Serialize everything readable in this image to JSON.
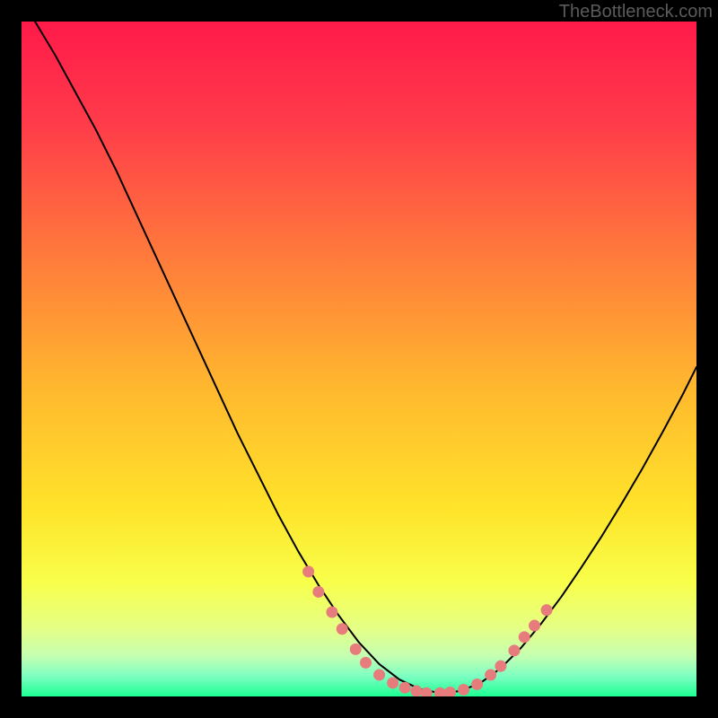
{
  "watermark": "TheBottleneck.com",
  "chart_data": {
    "type": "line",
    "title": "",
    "xlabel": "",
    "ylabel": "",
    "xlim": [
      0,
      100
    ],
    "ylim": [
      0,
      100
    ],
    "grid": false,
    "legend": false,
    "background_gradient": {
      "stops": [
        {
          "offset": 0.0,
          "color": "#ff1a4a"
        },
        {
          "offset": 0.15,
          "color": "#ff3b4a"
        },
        {
          "offset": 0.35,
          "color": "#ff7b3b"
        },
        {
          "offset": 0.55,
          "color": "#ffba2e"
        },
        {
          "offset": 0.72,
          "color": "#ffe32a"
        },
        {
          "offset": 0.83,
          "color": "#f8ff4a"
        },
        {
          "offset": 0.9,
          "color": "#e5ff87"
        },
        {
          "offset": 0.94,
          "color": "#c5ffb1"
        },
        {
          "offset": 0.97,
          "color": "#7dffc2"
        },
        {
          "offset": 1.0,
          "color": "#1cff93"
        }
      ]
    },
    "series": [
      {
        "name": "bottleneck-curve",
        "color": "#000000",
        "stroke_width": 2,
        "x": [
          2,
          5,
          8,
          11,
          14,
          17,
          20,
          23,
          26,
          29,
          32,
          35,
          38,
          41,
          44,
          47,
          50,
          53,
          56,
          59,
          62,
          65,
          68,
          71,
          74,
          77,
          80,
          83,
          86,
          89,
          92,
          95,
          98,
          100
        ],
        "y": [
          100,
          95,
          89.5,
          84,
          78,
          71.5,
          65,
          58.5,
          52,
          45.5,
          39,
          33,
          27,
          21.5,
          16.5,
          12,
          8,
          4.8,
          2.5,
          1.1,
          0.5,
          0.8,
          2.0,
          4.2,
          7.2,
          10.8,
          14.8,
          19.2,
          23.8,
          28.7,
          33.8,
          39.2,
          44.8,
          48.8
        ]
      }
    ],
    "scatter": {
      "name": "marked-points",
      "color": "#e77c7c",
      "radius": 6.5,
      "points": [
        {
          "x": 42.5,
          "y": 18.5
        },
        {
          "x": 44.0,
          "y": 15.5
        },
        {
          "x": 46.0,
          "y": 12.5
        },
        {
          "x": 47.5,
          "y": 10.0
        },
        {
          "x": 49.5,
          "y": 7.0
        },
        {
          "x": 51.0,
          "y": 5.0
        },
        {
          "x": 53.0,
          "y": 3.2
        },
        {
          "x": 55.0,
          "y": 2.0
        },
        {
          "x": 56.8,
          "y": 1.3
        },
        {
          "x": 58.5,
          "y": 0.8
        },
        {
          "x": 60.0,
          "y": 0.5
        },
        {
          "x": 62.0,
          "y": 0.5
        },
        {
          "x": 63.5,
          "y": 0.6
        },
        {
          "x": 65.5,
          "y": 1.0
        },
        {
          "x": 67.5,
          "y": 1.8
        },
        {
          "x": 69.5,
          "y": 3.2
        },
        {
          "x": 71.0,
          "y": 4.5
        },
        {
          "x": 73.0,
          "y": 6.8
        },
        {
          "x": 74.5,
          "y": 8.8
        },
        {
          "x": 76.0,
          "y": 10.5
        },
        {
          "x": 77.8,
          "y": 12.8
        }
      ]
    }
  }
}
